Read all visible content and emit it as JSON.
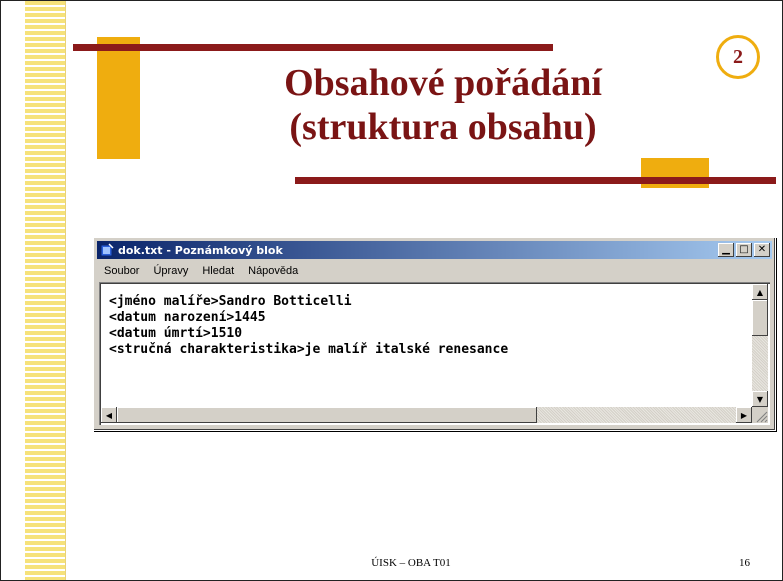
{
  "slide": {
    "badge": "2",
    "title_line1": "Obsahové pořádání",
    "title_line2": "(struktura obsahu)",
    "footer": "ÚISK – OBA T01",
    "page_number": "16"
  },
  "window": {
    "title": "dok.txt - Poznámkový blok",
    "menu": [
      "Soubor",
      "Úpravy",
      "Hledat",
      "Nápověda"
    ],
    "lines": [
      "<jméno malíře>Sandro Botticelli",
      "<datum narození>1445",
      "<datum úmrtí>1510",
      "<stručná charakteristika>je malíř italské renesance"
    ]
  },
  "colors": {
    "title": "#7a1414",
    "accent_bar": "#8b1a1a",
    "gold": "#efad0f",
    "titlebar_start": "#0a246a",
    "titlebar_end": "#a6caf0"
  }
}
